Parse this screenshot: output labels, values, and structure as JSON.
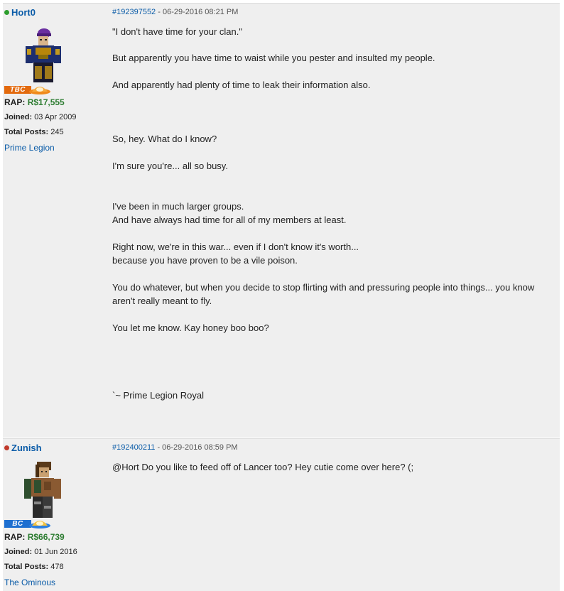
{
  "posts": [
    {
      "user": {
        "name": "Hort0",
        "status_color": "#2e9e2e",
        "badge_label": "TBC",
        "badge_color": "#e36a0e",
        "rap_label": "RAP",
        "rap_value": "R$17,555",
        "joined_label": "Joined:",
        "joined_value": "03 Apr 2009",
        "posts_label": "Total Posts:",
        "posts_value": "245",
        "group": "Prime Legion"
      },
      "post_id": "#192397552",
      "timestamp": "- 06-29-2016 08:21 PM",
      "lines": [
        "\"I don't have time for your clan.\"",
        "But apparently you have time to waist while you pester and insulted my people.",
        "And apparently had plenty of time to leak their information also.",
        "So, hey. What do I know?",
        "I'm sure you're... all so busy.",
        "I've been in much larger groups.",
        "And have always had time for all of my members at least.",
        "Right now, we're in this war... even if I don't know it's worth...",
        "because you have proven to be a vile poison.",
        "You do whatever, but when you decide to stop flirting with and pressuring people into things... you know",
        "aren't really meant to fly.",
        "You let me know. Kay honey boo boo?",
        "`~ Prime Legion Royal"
      ]
    },
    {
      "user": {
        "name": "Zunish",
        "status_color": "#c0392b",
        "badge_label": "BC",
        "badge_color": "#1e6fd0",
        "rap_label": "RAP",
        "rap_value": "R$66,739",
        "joined_label": "Joined:",
        "joined_value": "01 Jun 2016",
        "posts_label": "Total Posts:",
        "posts_value": "478",
        "group": "The Ominous"
      },
      "post_id": "#192400211",
      "timestamp": "- 06-29-2016 08:59 PM",
      "lines": [
        "@Hort Do you like to feed off of Lancer too? Hey cutie come over here? (;"
      ]
    }
  ]
}
